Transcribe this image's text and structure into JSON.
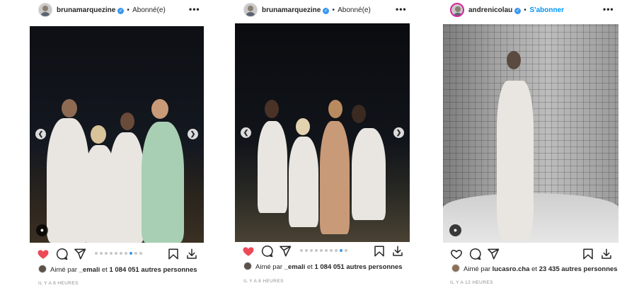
{
  "posts": [
    {
      "username": "brunamarquezine",
      "verified_mark": "✓",
      "separator": "•",
      "follow_label": "Abonné(e)",
      "more_label": "•••",
      "liked": true,
      "carousel": {
        "count": 10,
        "active": 7,
        "prev_icon": "chevron-left-icon",
        "next_icon": "chevron-right-icon"
      },
      "likes": {
        "prefix": "Aimé par",
        "user": "_emali",
        "conjunction": "et",
        "count": "1 084 051 autres personnes"
      },
      "time": "IL Y A 8 HEURES"
    },
    {
      "username": "brunamarquezine",
      "verified_mark": "✓",
      "separator": "•",
      "follow_label": "Abonné(e)",
      "more_label": "•••",
      "liked": true,
      "carousel": {
        "count": 10,
        "active": 8,
        "prev_icon": "chevron-left-icon",
        "next_icon": "chevron-right-icon"
      },
      "likes": {
        "prefix": "Aimé par",
        "user": "_emali",
        "conjunction": "et",
        "count": "1 084 051 autres personnes"
      },
      "time": "IL Y A 8 HEURES"
    },
    {
      "username": "andrenicolau",
      "verified_mark": "✓",
      "separator": "•",
      "follow_label": "S'abonner",
      "more_label": "•••",
      "liked": false,
      "likes": {
        "prefix": "Aimé par",
        "user": "lucasro.cha",
        "conjunction": "et",
        "count": "23 435 autres personnes"
      },
      "time": "IL Y A 12 HEURES"
    }
  ],
  "colors": {
    "like_red": "#ed4956",
    "accent_blue": "#0095f6",
    "text": "#262626",
    "muted": "#8e8e8e"
  }
}
